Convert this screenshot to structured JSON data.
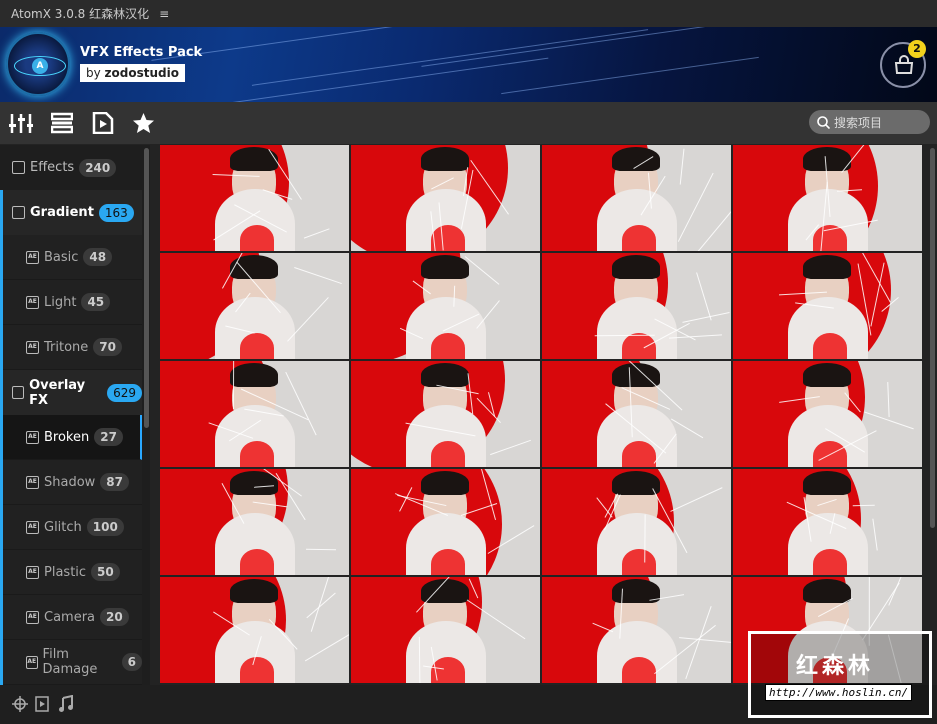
{
  "app": {
    "title": "AtomX 3.0.8 红森林汉化",
    "menu_icon": "hamburger-icon"
  },
  "banner": {
    "title": "VFX Effects Pack",
    "by": "by",
    "author": "zodostudio",
    "cart_count": "2"
  },
  "search": {
    "placeholder": "搜索项目"
  },
  "sidebar": {
    "items": [
      {
        "label": "Effects",
        "count": "240",
        "type": "root"
      },
      {
        "label": "Gradient",
        "count": "163",
        "type": "cat"
      },
      {
        "label": "Basic",
        "count": "48",
        "type": "sub"
      },
      {
        "label": "Light",
        "count": "45",
        "type": "sub"
      },
      {
        "label": "Tritone",
        "count": "70",
        "type": "sub"
      },
      {
        "label": "Overlay FX",
        "count": "629",
        "type": "cat"
      },
      {
        "label": "Broken",
        "count": "27",
        "type": "sub",
        "selected": true
      },
      {
        "label": "Shadow",
        "count": "87",
        "type": "sub"
      },
      {
        "label": "Glitch",
        "count": "100",
        "type": "sub"
      },
      {
        "label": "Plastic",
        "count": "50",
        "type": "sub"
      },
      {
        "label": "Camera",
        "count": "20",
        "type": "sub"
      },
      {
        "label": "Film Damage",
        "count": "6",
        "type": "sub"
      }
    ]
  },
  "grid": {
    "rows": 5,
    "cols": 4
  },
  "watermark": {
    "text": "红森林",
    "url": "http://www.hoslin.cn/"
  },
  "colors": {
    "accent": "#2aa8f2",
    "badge": "#f3d21c"
  }
}
